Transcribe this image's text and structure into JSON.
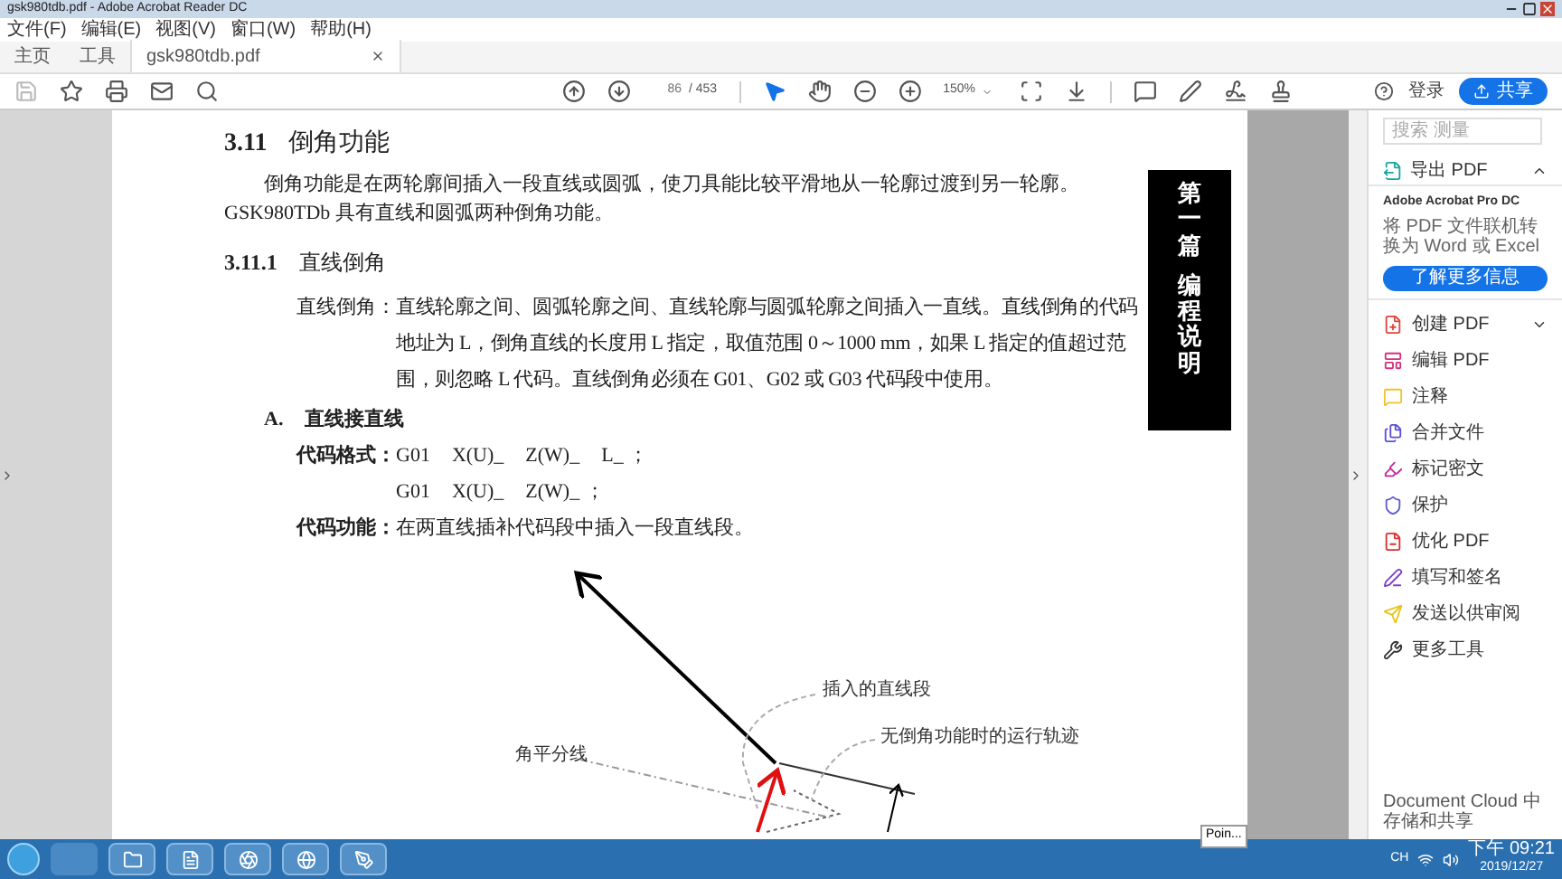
{
  "window": {
    "title": "gsk980tdb.pdf - Adobe Acrobat Reader DC"
  },
  "menu": [
    "文件(F)",
    "编辑(E)",
    "视图(V)",
    "窗口(W)",
    "帮助(H)"
  ],
  "tabs": [
    {
      "label": "主页",
      "selected": false,
      "closable": false
    },
    {
      "label": "工具",
      "selected": false,
      "closable": false
    },
    {
      "label": "gsk980tdb.pdf",
      "selected": true,
      "closable": true
    }
  ],
  "toolbar": {
    "page": "86",
    "page_total": "/ 453",
    "zoom": "150%",
    "sign_in": "登录",
    "share": "共享"
  },
  "document": {
    "heading": {
      "number": "3.11",
      "title": "倒角功能"
    },
    "intro": "倒角功能是在两轮廓间插入一段直线或圆弧，使刀具能比较平滑地从一轮廓过渡到另一轮廓。GSK980TDb 具有直线和圆弧两种倒角功能。",
    "subheading": {
      "number": "3.11.1",
      "title": "直线倒角"
    },
    "definition": {
      "term": "直线倒角：",
      "text": "直线轮廓之间、圆弧轮廓之间、直线轮廓与圆弧轮廓之间插入一直线。直线倒角的代码地址为 L，倒角直线的长度用 L 指定，取值范围 0～1000 mm，如果 L 指定的值超过范围，则忽略 L 代码。直线倒角必须在 G01、G02 或 G03 代码段中使用。"
    },
    "subsection": {
      "letter": "A.",
      "title": "直线接直线"
    },
    "format": {
      "label": "代码格式：",
      "lines": [
        [
          "G01",
          "X(U)_",
          "Z(W)_",
          "L_ ；"
        ],
        [
          "G01",
          "X(U)_",
          "Z(W)_ ；"
        ]
      ]
    },
    "function": {
      "label": "代码功能：",
      "text": "在两直线插补代码段中插入一段直线段。"
    },
    "diagram": {
      "labels": [
        "插入的直线段",
        "无倒角功能时的运行轨迹",
        "角平分线"
      ]
    },
    "side_tab": [
      "第一篇",
      "编程说明"
    ]
  },
  "right_pane": {
    "search": {
      "placeholder": "搜索 测量"
    },
    "export": {
      "label": "导出 PDF",
      "expanded": true,
      "product": "Adobe Acrobat Pro DC",
      "description": "将 PDF 文件联机转换为 Word 或 Excel",
      "button": "了解更多信息"
    },
    "tools": [
      {
        "label": "创建 PDF",
        "color": "#e0443c",
        "kind": "menu"
      },
      {
        "label": "编辑 PDF",
        "color": "#d4317a",
        "kind": "tool"
      },
      {
        "label": "注释",
        "color": "#f2c12e",
        "kind": "tool"
      },
      {
        "label": "合并文件",
        "color": "#5b4fd8",
        "kind": "tool"
      },
      {
        "label": "标记密文",
        "color": "#c3289e",
        "kind": "tool"
      },
      {
        "label": "保护",
        "color": "#5b5bd6",
        "kind": "tool"
      },
      {
        "label": "优化 PDF",
        "color": "#d9302c",
        "kind": "tool"
      },
      {
        "label": "填写和签名",
        "color": "#7b3fd0",
        "kind": "tool"
      },
      {
        "label": "发送以供审阅",
        "color": "#e8c51a",
        "kind": "tool"
      },
      {
        "label": "更多工具",
        "color": "#333333",
        "kind": "tool"
      }
    ],
    "cloud_note": "Document Cloud 中存储和共享"
  },
  "tooltip": "Poin...",
  "taskbar": {
    "language": "CH",
    "time": "下午 09:21",
    "date": "2019/12/27"
  }
}
